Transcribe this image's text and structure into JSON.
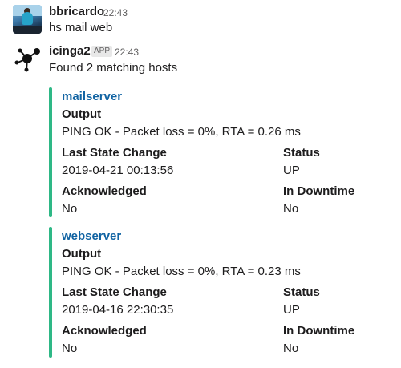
{
  "messages": [
    {
      "author": "bbricardo",
      "time": "22:43",
      "text": "hs mail web",
      "avatar_icon": "user-photo-avatar"
    },
    {
      "author": "icinga2",
      "badge": "APP",
      "time": "22:43",
      "text": "Found 2 matching hosts",
      "avatar_icon": "icinga-logo-icon",
      "attachments": [
        {
          "title": "mailserver",
          "color": "#2eb886",
          "fields": {
            "output_title": "Output",
            "output_value": "PING OK - Packet loss = 0%, RTA = 0.26 ms",
            "last_state_change_title": "Last State Change",
            "last_state_change_value": "2019-04-21 00:13:56",
            "status_title": "Status",
            "status_value": "UP",
            "acknowledged_title": "Acknowledged",
            "acknowledged_value": "No",
            "in_downtime_title": "In Downtime",
            "in_downtime_value": "No"
          }
        },
        {
          "title": "webserver",
          "color": "#2eb886",
          "fields": {
            "output_title": "Output",
            "output_value": "PING OK - Packet loss = 0%, RTA = 0.23 ms",
            "last_state_change_title": "Last State Change",
            "last_state_change_value": "2019-04-16 22:30:35",
            "status_title": "Status",
            "status_value": "UP",
            "acknowledged_title": "Acknowledged",
            "acknowledged_value": "No",
            "in_downtime_title": "In Downtime",
            "in_downtime_value": "No"
          }
        }
      ]
    }
  ],
  "colors": {
    "link": "#1264a3",
    "attachment_bar": "#2eb886",
    "text": "#1d1c1d",
    "muted": "#616061"
  }
}
